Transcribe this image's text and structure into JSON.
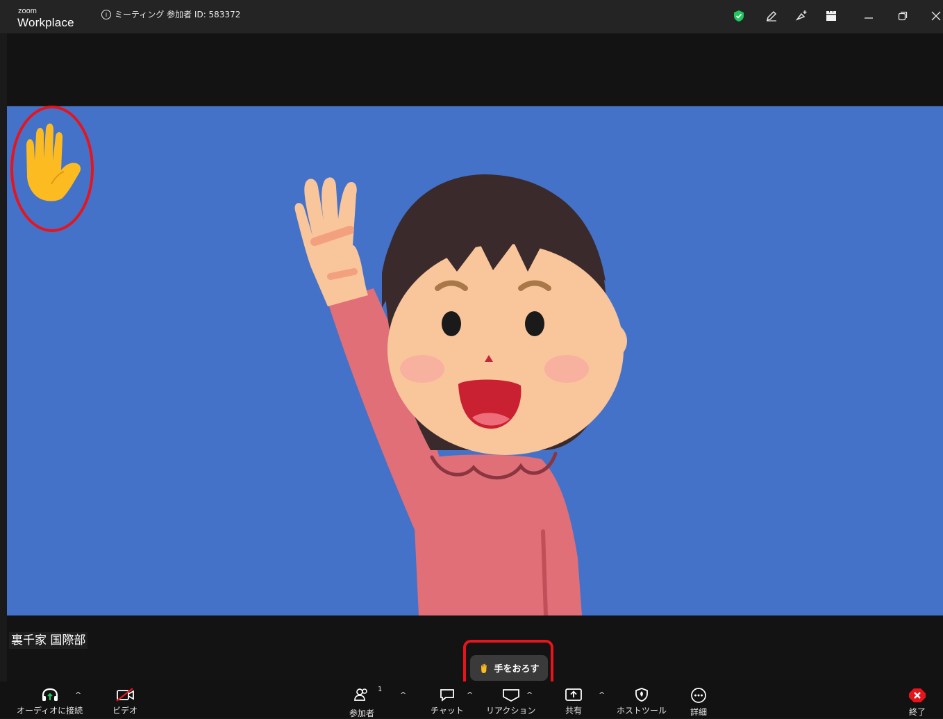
{
  "app": {
    "logo_small": "zoom",
    "logo_big": "Workplace"
  },
  "meeting": {
    "info_icon": "info-icon",
    "info_text": "ミーティング 参加者 ID: 583372"
  },
  "title_icons": [
    "shield-check-icon",
    "pencil-icon",
    "sparkle-icon",
    "apps-icon",
    "minimize-icon",
    "restore-icon",
    "close-icon"
  ],
  "video": {
    "participant_name": "裏千家 国際部",
    "raised_hand_icon": "raised-hand-icon"
  },
  "lower_hand": {
    "icon": "hand-icon",
    "label": "手をおろす"
  },
  "toolbar": {
    "audio": "オーディオに接続",
    "video": "ビデオ",
    "participants": "参加者",
    "participants_count": "1",
    "chat": "チャット",
    "reaction": "リアクション",
    "share": "共有",
    "host_tools": "ホストツール",
    "more": "詳細",
    "end": "終了"
  },
  "colors": {
    "video_bg": "#4472c9",
    "highlight": "#e8141b",
    "shield": "#22c55e",
    "end": "#e8141b"
  }
}
